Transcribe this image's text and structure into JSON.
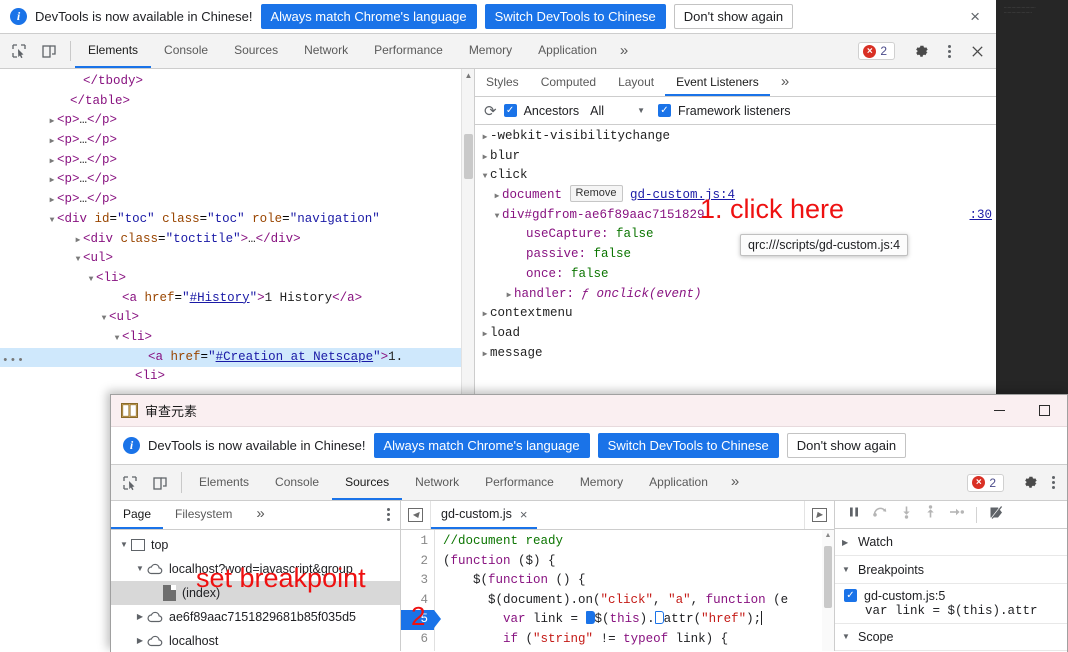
{
  "window1": {
    "banner": {
      "info_icon": "info-icon",
      "message": "DevTools is now available in Chinese!",
      "btn_always": "Always match Chrome's language",
      "btn_switch": "Switch DevTools to Chinese",
      "btn_dismiss": "Don't show again",
      "close_glyph": "×"
    },
    "tabs": [
      {
        "label": "Elements",
        "active": true
      },
      {
        "label": "Console",
        "active": false
      },
      {
        "label": "Sources",
        "active": false
      },
      {
        "label": "Network",
        "active": false
      },
      {
        "label": "Performance",
        "active": false
      },
      {
        "label": "Memory",
        "active": false
      },
      {
        "label": "Application",
        "active": false
      }
    ],
    "tab_overflow": "»",
    "error_count": "2",
    "error_glyph": "×",
    "dom_rows": [
      {
        "indent": 5,
        "arrow": "none",
        "html": "<span class=\"punct\">&lt;/tbody&gt;</span>"
      },
      {
        "indent": 4,
        "arrow": "none",
        "html": "<span class=\"punct\">&lt;/table&gt;</span>"
      },
      {
        "indent": 3,
        "arrow": "right",
        "html": "<span class=\"tagname\">&lt;p&gt;</span><span class=\"txt\">…</span><span class=\"tagname\">&lt;/p&gt;</span>"
      },
      {
        "indent": 3,
        "arrow": "right",
        "html": "<span class=\"tagname\">&lt;p&gt;</span><span class=\"txt\">…</span><span class=\"tagname\">&lt;/p&gt;</span>"
      },
      {
        "indent": 3,
        "arrow": "right",
        "html": "<span class=\"tagname\">&lt;p&gt;</span><span class=\"txt\">…</span><span class=\"tagname\">&lt;/p&gt;</span>"
      },
      {
        "indent": 3,
        "arrow": "right",
        "html": "<span class=\"tagname\">&lt;p&gt;</span><span class=\"txt\">…</span><span class=\"tagname\">&lt;/p&gt;</span>"
      },
      {
        "indent": 3,
        "arrow": "right",
        "html": "<span class=\"tagname\">&lt;p&gt;</span><span class=\"txt\">…</span><span class=\"tagname\">&lt;/p&gt;</span>"
      },
      {
        "indent": 3,
        "arrow": "down",
        "html": "<span class=\"tagname\">&lt;div</span> <span class=\"attrname\">id</span>=<span class=\"attrval\">\"toc\"</span> <span class=\"attrname\">class</span>=<span class=\"attrval\">\"toc\"</span> <span class=\"attrname\">role</span>=<span class=\"attrval\">\"navigation\"</span>"
      },
      {
        "indent": 5,
        "arrow": "right",
        "html": "<span class=\"tagname\">&lt;div</span> <span class=\"attrname\">class</span>=<span class=\"attrval\">\"toctitle\"</span><span class=\"tagname\">&gt;</span><span class=\"txt\">…</span><span class=\"tagname\">&lt;/div&gt;</span>"
      },
      {
        "indent": 5,
        "arrow": "down",
        "html": "<span class=\"tagname\">&lt;ul&gt;</span>"
      },
      {
        "indent": 6,
        "arrow": "down",
        "html": "<span class=\"tagname\">&lt;li&gt;</span>"
      },
      {
        "indent": 8,
        "arrow": "none",
        "html": "<span class=\"tagname\">&lt;a</span> <span class=\"attrname\">href</span>=<span class=\"attrval\">\"</span><span class=\"lnk\">#History</span><span class=\"attrval\">\"</span><span class=\"tagname\">&gt;</span><span class=\"txt\">1 History</span><span class=\"tagname\">&lt;/a&gt;</span>"
      },
      {
        "indent": 7,
        "arrow": "down",
        "html": "<span class=\"tagname\">&lt;ul&gt;</span>"
      },
      {
        "indent": 8,
        "arrow": "down",
        "html": "<span class=\"tagname\">&lt;li&gt;</span>"
      },
      {
        "indent": 10,
        "arrow": "none",
        "selected": true,
        "dots": "•••",
        "html": "<span class=\"tagname\">&lt;a</span> <span class=\"attrname\">href</span>=<span class=\"attrval\">\"</span><span class=\"lnk\">#Creation_at_Netscape</span><span class=\"attrval\">\"</span><span class=\"tagname\">&gt;</span><span class=\"txt\">1.</span>"
      },
      {
        "indent": 9,
        "arrow": "none",
        "html": "<span class=\"tagname\">&lt;li&gt;</span>"
      }
    ],
    "sidebar": {
      "tabs": [
        {
          "label": "Styles",
          "active": false
        },
        {
          "label": "Computed",
          "active": false
        },
        {
          "label": "Layout",
          "active": false
        },
        {
          "label": "Event Listeners",
          "active": true
        }
      ],
      "tab_overflow": "»",
      "toolbar": {
        "refresh_glyph": "⟳",
        "ancestors_label": "Ancestors",
        "filter_value": "All",
        "caret_glyph": "▼",
        "framework_label": "Framework listeners",
        "checked_glyph": "✓"
      },
      "listeners": [
        {
          "indent": 0,
          "arrow": "right",
          "text": "-webkit-visibilitychange",
          "kind": "name"
        },
        {
          "indent": 0,
          "arrow": "right",
          "text": "blur",
          "kind": "name"
        },
        {
          "indent": 0,
          "arrow": "down",
          "text": "click",
          "kind": "name"
        },
        {
          "indent": 1,
          "arrow": "right",
          "kind": "document",
          "node": "document",
          "remove_label": "Remove",
          "source": "gd-custom.js:4"
        },
        {
          "indent": 1,
          "arrow": "down",
          "kind": "div",
          "node": "div#gdfrom-ae6f89aac7151829",
          "source_tail": ":30"
        },
        {
          "indent": 3,
          "arrow": "none",
          "kind": "prop",
          "key": "useCapture:",
          "val": "false"
        },
        {
          "indent": 3,
          "arrow": "none",
          "kind": "prop",
          "key": "passive:",
          "val": "false"
        },
        {
          "indent": 3,
          "arrow": "none",
          "kind": "prop",
          "key": "once:",
          "val": "false"
        },
        {
          "indent": 2,
          "arrow": "right",
          "kind": "handler",
          "key": "handler:",
          "fn": "ƒ onclick(event)"
        },
        {
          "indent": 0,
          "arrow": "right",
          "text": "contextmenu",
          "kind": "name"
        },
        {
          "indent": 0,
          "arrow": "right",
          "text": "load",
          "kind": "name"
        },
        {
          "indent": 0,
          "arrow": "right",
          "text": "message",
          "kind": "name"
        }
      ],
      "tooltip": "qrc:///scripts/gd-custom.js:4"
    },
    "annotation": "1. click here"
  },
  "window2": {
    "titlebar": {
      "title": "审查元素",
      "icon": "book-icon",
      "minimize_glyph": "—",
      "maximize_glyph": "□"
    },
    "banner": {
      "message": "DevTools is now available in Chinese!",
      "btn_always": "Always match Chrome's language",
      "btn_switch": "Switch DevTools to Chinese",
      "btn_dismiss": "Don't show again"
    },
    "tabs": [
      {
        "label": "Elements",
        "active": false
      },
      {
        "label": "Console",
        "active": false
      },
      {
        "label": "Sources",
        "active": true
      },
      {
        "label": "Network",
        "active": false
      },
      {
        "label": "Performance",
        "active": false
      },
      {
        "label": "Memory",
        "active": false
      },
      {
        "label": "Application",
        "active": false
      }
    ],
    "tab_overflow": "»",
    "error_count": "2",
    "navigator": {
      "tabs": [
        {
          "label": "Page",
          "active": true
        },
        {
          "label": "Filesystem",
          "active": false
        }
      ],
      "tab_overflow": "»",
      "tree": [
        {
          "indent": 0,
          "tri": "down",
          "icon": "frame",
          "label": "top",
          "selected": false
        },
        {
          "indent": 1,
          "tri": "down",
          "icon": "cloud",
          "label": "localhost?word=javascript&group",
          "selected": false
        },
        {
          "indent": 2,
          "tri": "none",
          "icon": "doc",
          "label": "(index)",
          "selected": true
        },
        {
          "indent": 1,
          "tri": "right",
          "icon": "cloud",
          "label": "ae6f89aac7151829681b85f035d5",
          "selected": false
        },
        {
          "indent": 1,
          "tri": "right",
          "icon": "cloud",
          "label": "localhost",
          "selected": false
        }
      ]
    },
    "editor": {
      "file_tab": "gd-custom.js",
      "close_glyph": "×",
      "lines": [
        {
          "n": "1",
          "bp": false,
          "html": "<span class=\"c-comment\">//document ready</span>"
        },
        {
          "n": "2",
          "bp": false,
          "html": "<span class=\"c-plain\">(</span><span class=\"c-kw\">function</span><span class=\"c-plain\"> ($) {</span>"
        },
        {
          "n": "3",
          "bp": false,
          "html": "<span class=\"c-plain\">    $(</span><span class=\"c-kw\">function</span><span class=\"c-plain\"> () {</span>"
        },
        {
          "n": "4",
          "bp": false,
          "html": "<span class=\"c-plain\">      $(document).on(</span><span class=\"c-str\">\"click\"</span><span class=\"c-plain\">, </span><span class=\"c-str\">\"a\"</span><span class=\"c-plain\">, </span><span class=\"c-kw\">function</span><span class=\"c-plain\"> (e</span>"
        },
        {
          "n": "5",
          "bp": true,
          "html": "<span class=\"c-plain\">        </span><span class=\"c-kw\">var</span><span class=\"c-plain\"> link = </span><span class=\"chip\"></span><span class=\"c-plain\">$(</span><span class=\"c-kw\">this</span><span class=\"c-plain\">).</span><span class=\"chip hollow\"></span><span class=\"c-plain\">attr(</span><span class=\"c-str\">\"href\"</span><span class=\"c-plain\">);</span>"
        },
        {
          "n": "6",
          "bp": false,
          "html": "<span class=\"c-plain\">        </span><span class=\"c-kw\">if</span><span class=\"c-plain\"> (</span><span class=\"c-str\">\"string\"</span><span class=\"c-plain\"> != </span><span class=\"c-kw\">typeof</span><span class=\"c-plain\"> link) {</span>"
        }
      ]
    },
    "debugger": {
      "controls": [
        {
          "name": "pause-button",
          "glyph": "pause"
        },
        {
          "name": "step-over-button",
          "glyph": "step-over"
        },
        {
          "name": "step-into-button",
          "glyph": "step-into"
        },
        {
          "name": "step-out-button",
          "glyph": "step-out"
        },
        {
          "name": "step-button",
          "glyph": "step"
        },
        {
          "name": "deactivate-breakpoints-button",
          "glyph": "deactivate"
        }
      ],
      "sections": [
        {
          "label": "Watch",
          "expanded": false
        },
        {
          "label": "Breakpoints",
          "expanded": true
        }
      ],
      "breakpoint": {
        "checked": true,
        "location": "gd-custom.js:5",
        "code": "var link = $(this).attr"
      },
      "scope_label": "Scope"
    },
    "annotation": "set breakpoint",
    "annotation_number": "2"
  },
  "colors": {
    "accent_blue": "#1a73e8",
    "error_red": "#d93025",
    "annotation_red": "#ee1111",
    "title_pink": "#faeff1",
    "toolbar_gray": "#f3f3f3",
    "selection_blue": "#cfe8fc"
  }
}
